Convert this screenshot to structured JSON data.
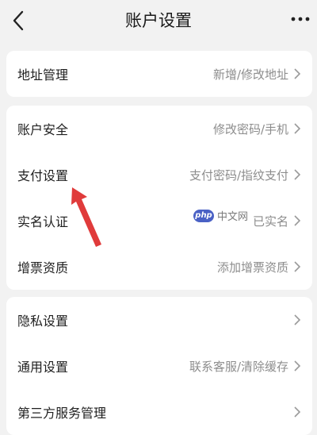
{
  "header": {
    "title": "账户设置"
  },
  "groups": [
    {
      "items": [
        {
          "label": "地址管理",
          "value": "新增/修改地址"
        }
      ]
    },
    {
      "items": [
        {
          "label": "账户安全",
          "value": "修改密码/手机"
        },
        {
          "label": "支付设置",
          "value": "支付密码/指纹支付"
        },
        {
          "label": "实名认证",
          "value": "已实名"
        },
        {
          "label": "增票资质",
          "value": "添加增票资质"
        }
      ]
    },
    {
      "items": [
        {
          "label": "隐私设置",
          "value": ""
        },
        {
          "label": "通用设置",
          "value": "联系客服/清除缓存"
        },
        {
          "label": "第三方服务管理",
          "value": ""
        }
      ]
    }
  ],
  "watermark": {
    "logo_text": "php",
    "text": "中文网"
  },
  "colors": {
    "background": "#f2f2f2",
    "card": "#ffffff",
    "arrow": "#e03b3b",
    "value_text": "#8d8d8d"
  }
}
